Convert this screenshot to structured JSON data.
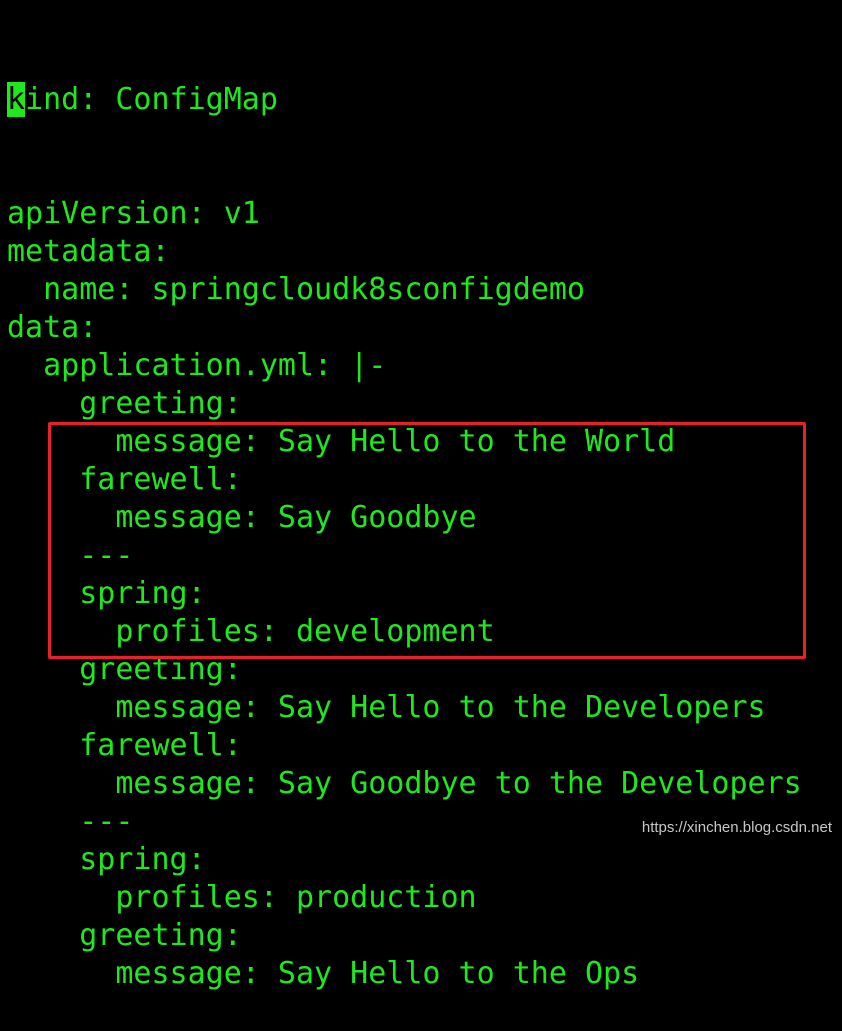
{
  "terminal": {
    "cursor_char": "k",
    "first_line_rest": "ind: ConfigMap",
    "lines": [
      "apiVersion: v1",
      "metadata:",
      "  name: springcloudk8sconfigdemo",
      "data:",
      "  application.yml: |-",
      "    greeting:",
      "      message: Say Hello to the World",
      "    farewell:",
      "      message: Say Goodbye",
      "    ---",
      "    spring:",
      "      profiles: development",
      "    greeting:",
      "      message: Say Hello to the Developers",
      "    farewell:",
      "      message: Say Goodbye to the Developers",
      "    ---",
      "    spring:",
      "      profiles: production",
      "    greeting:",
      "      message: Say Hello to the Ops"
    ],
    "text_color": "#1fe81f",
    "highlight_color": "#e8202a"
  },
  "watermark": "https://xinchen.blog.csdn.net"
}
